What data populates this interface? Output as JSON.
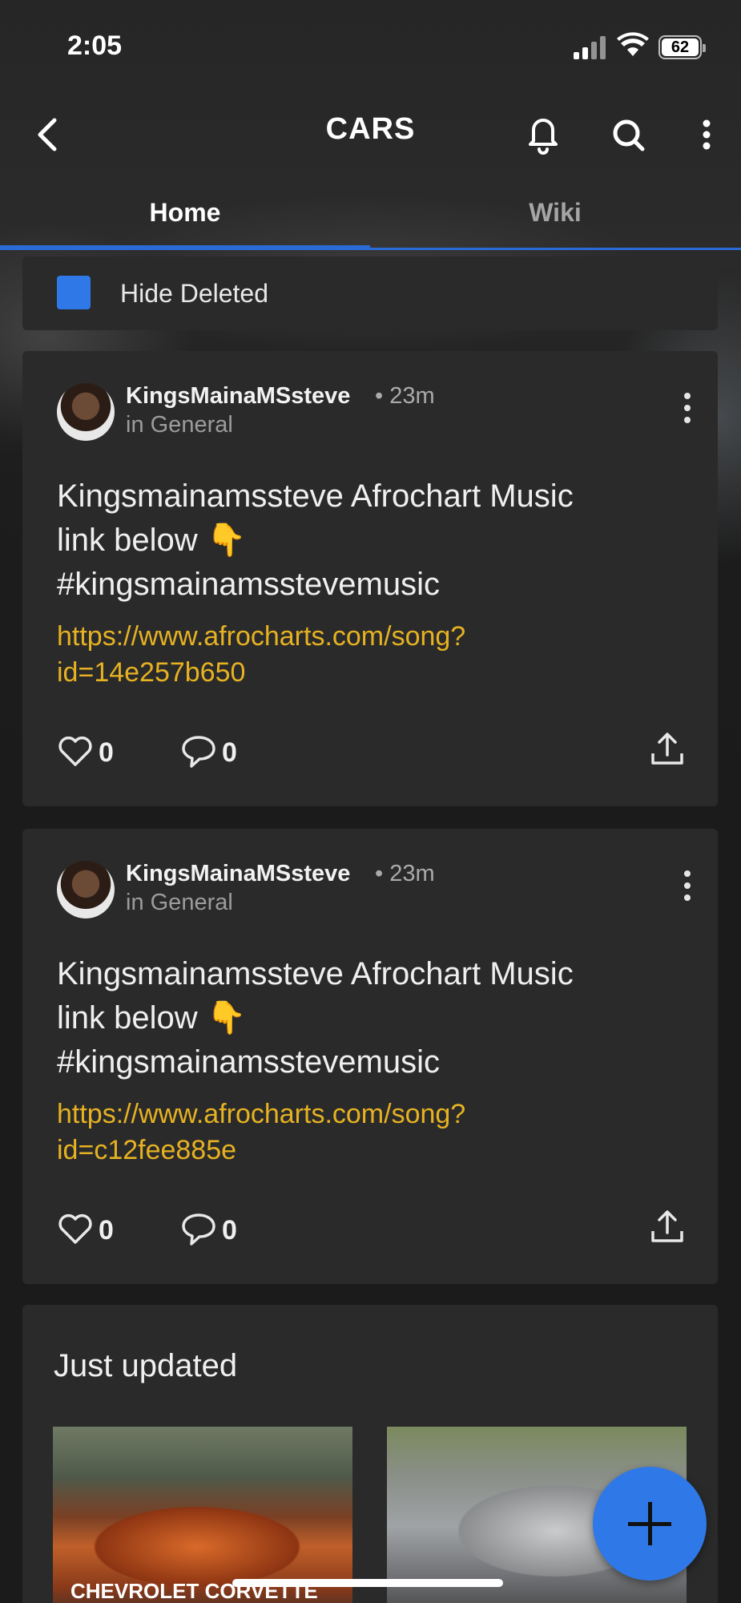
{
  "status_bar": {
    "time": "2:05",
    "battery": "62"
  },
  "header": {
    "title": "CARS"
  },
  "tabs": [
    {
      "label": "Home",
      "active": true
    },
    {
      "label": "Wiki",
      "active": false
    }
  ],
  "filter": {
    "hide_deleted_label": "Hide Deleted",
    "checked": true
  },
  "posts": [
    {
      "author": "KingsMainaMSsteve",
      "time_ago": "• 23m",
      "category": "in General",
      "line1": "Kingsmainamssteve Afrochart Music",
      "line2": "link below 👇",
      "line3": "#kingsmainamsstevemusic",
      "link_line1": "https://www.afrocharts.com/song?",
      "link_line2": "id=14e257b650",
      "likes": "0",
      "comments": "0"
    },
    {
      "author": "KingsMainaMSsteve",
      "time_ago": "• 23m",
      "category": "in General",
      "line1": "Kingsmainamssteve Afrochart Music",
      "line2": "link below 👇",
      "line3": "#kingsmainamsstevemusic",
      "link_line1": "https://www.afrocharts.com/song?",
      "link_line2": "id=c12fee885e",
      "likes": "0",
      "comments": "0"
    }
  ],
  "just_updated": {
    "title": "Just updated",
    "cards": [
      {
        "caption": "CHEVROLET CORVETTE"
      },
      {
        "caption": ""
      }
    ]
  },
  "colors": {
    "accent": "#2f78e8",
    "link": "#e6b222",
    "card_bg": "#2a2a2a",
    "background": "#1b1b1b"
  }
}
